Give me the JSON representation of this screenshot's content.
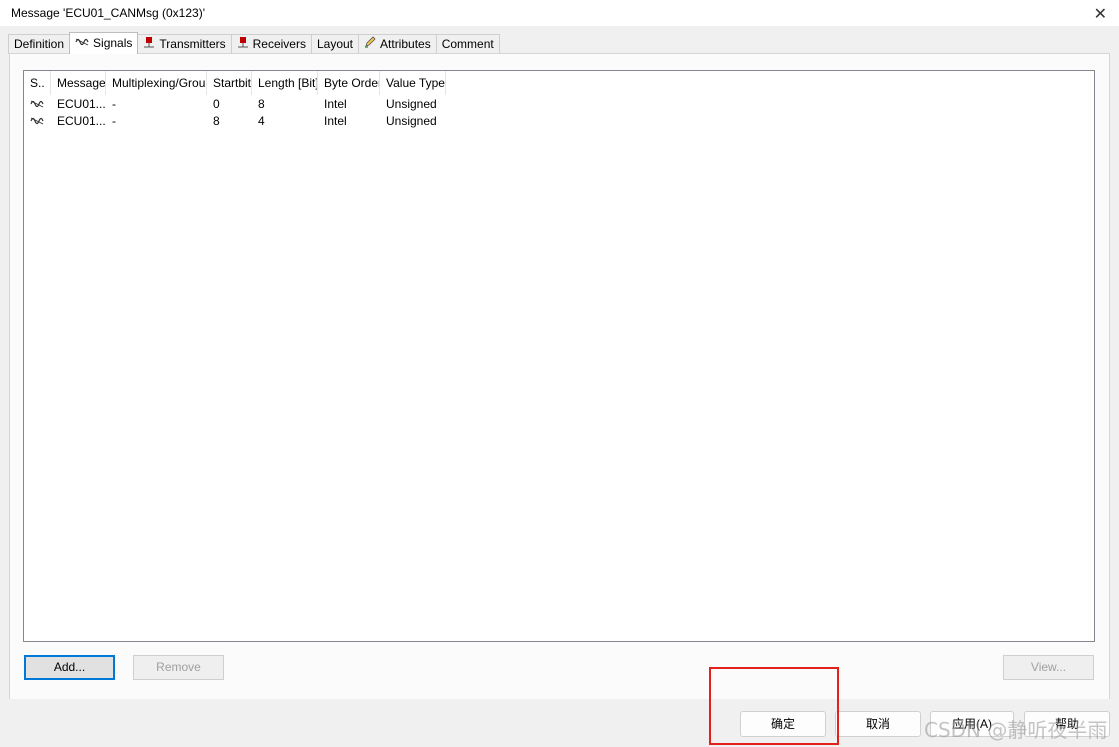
{
  "window": {
    "title": "Message 'ECU01_CANMsg (0x123)'",
    "close_glyph": "✕"
  },
  "tabs": [
    {
      "label": "Definition",
      "icon": null
    },
    {
      "label": "Signals",
      "icon": "signal-wave-icon",
      "active": true
    },
    {
      "label": "Transmitters",
      "icon": "transmitter-pin-icon"
    },
    {
      "label": "Receivers",
      "icon": "receiver-pin-icon"
    },
    {
      "label": "Layout",
      "icon": null
    },
    {
      "label": "Attributes",
      "icon": "pencil-icon"
    },
    {
      "label": "Comment",
      "icon": null
    }
  ],
  "signals_table": {
    "columns": [
      "S..",
      "Message",
      "Multiplexing/Group",
      "Startbit",
      "Length [Bit]",
      "Byte Order",
      "Value Type"
    ],
    "rows": [
      {
        "message": "ECU01...",
        "mux": "-",
        "startbit": "0",
        "length": "8",
        "byte_order": "Intel",
        "value_type": "Unsigned"
      },
      {
        "message": "ECU01...",
        "mux": "-",
        "startbit": "8",
        "length": "4",
        "byte_order": "Intel",
        "value_type": "Unsigned"
      }
    ]
  },
  "actions": {
    "add": "Add...",
    "remove": "Remove",
    "view": "View..."
  },
  "dialog_buttons": {
    "ok": "确定",
    "cancel": "取消",
    "apply": "应用(A)",
    "help": "帮助"
  },
  "watermark": "CSDN @静听夜半雨",
  "colors": {
    "highlight": "#e3211c",
    "focus": "#0078d7",
    "accent_red_icon": "#c00000"
  }
}
